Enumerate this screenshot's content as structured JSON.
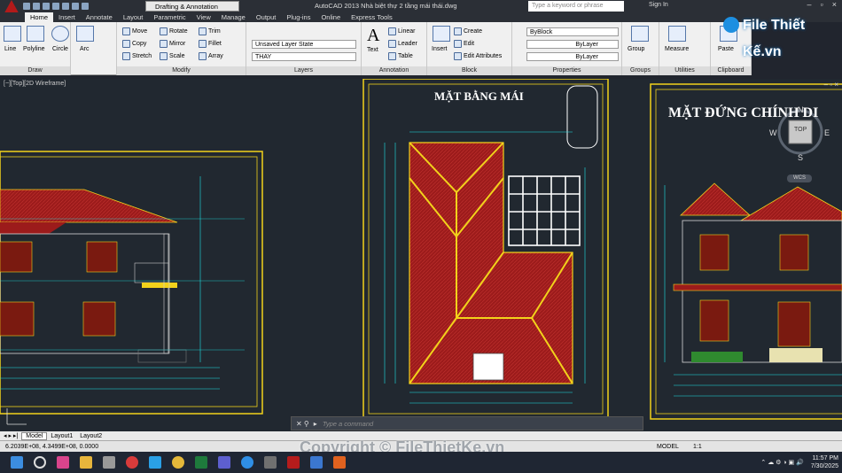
{
  "titlebar": {
    "workspace": "Drafting & Annotation",
    "app_title": "AutoCAD 2013    Nhà biệt thự 2 tầng mái thái.dwg",
    "search_placeholder": "Type a keyword or phrase",
    "sign_in": "Sign In"
  },
  "ribbon_tabs": [
    "Home",
    "Insert",
    "Annotate",
    "Layout",
    "Parametric",
    "View",
    "Manage",
    "Output",
    "Plug-ins",
    "Online",
    "Express Tools"
  ],
  "ribbon": {
    "draw": {
      "label": "Draw",
      "tools": [
        "Line",
        "Polyline",
        "Circle",
        "Arc"
      ]
    },
    "modify": {
      "label": "Modify",
      "tools": [
        "Move",
        "Rotate",
        "Trim",
        "Copy",
        "Mirror",
        "Fillet",
        "Stretch",
        "Scale",
        "Array"
      ]
    },
    "layers": {
      "label": "Layers",
      "layer_state": "Unsaved Layer State",
      "current_layer": "THAY"
    },
    "annotation": {
      "label": "Annotation",
      "text": "Text",
      "linear": "Linear",
      "leader": "Leader",
      "table": "Table"
    },
    "block": {
      "label": "Block",
      "insert": "Insert",
      "create": "Create",
      "edit": "Edit",
      "edit_attributes": "Edit Attributes"
    },
    "properties": {
      "label": "Properties",
      "color": "ByBlock",
      "linetype": "ByLayer",
      "lineweight": "ByLayer"
    },
    "groups": {
      "label": "Groups",
      "group": "Group"
    },
    "utilities": {
      "label": "Utilities",
      "measure": "Measure"
    },
    "clipboard": {
      "label": "Clipboard",
      "paste": "Paste"
    }
  },
  "brand": {
    "logo_text": "File Thiết Kế.vn"
  },
  "viewport": {
    "label": "[−][Top][2D Wireframe]",
    "roof_plan_title": "MẶT BẰNG MÁI",
    "elevation_title": "MẶT ĐỨNG CHÍNH DI",
    "viewcube": {
      "top": "TOP",
      "north": "N",
      "south": "S",
      "west": "W",
      "east": "E",
      "wcs": "WCS"
    }
  },
  "command": {
    "placeholder": "Type a command"
  },
  "layout_tabs": [
    "Model",
    "Layout1",
    "Layout2"
  ],
  "status": {
    "coords": "6.2039E+08, 4.3499E+08, 0.0000",
    "model": "MODEL",
    "scale": "1:1"
  },
  "watermark": "Copyright © FileThietKe.vn",
  "taskbar": {
    "time": "11:57 PM",
    "date": "7/30/2025"
  },
  "colors": {
    "roof": "#9c1b1b",
    "frame": "#f2d21b",
    "dims": "#1ee4e8",
    "accent": "#f0f0f0"
  }
}
